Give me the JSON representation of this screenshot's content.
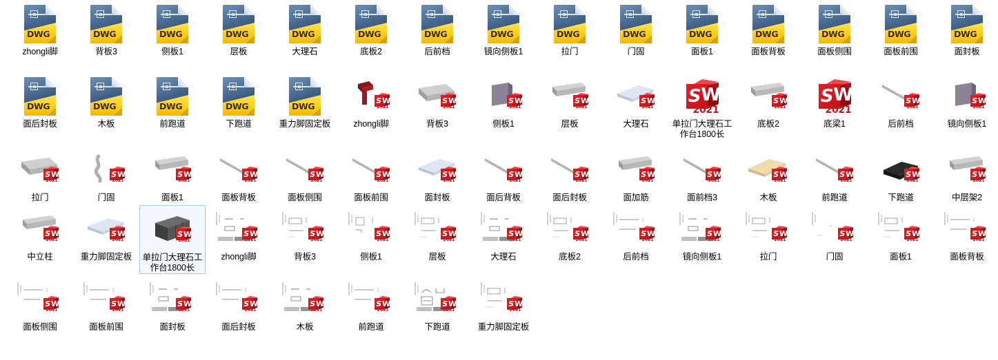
{
  "window": {
    "view_mode": "medium-icons-grid",
    "background_color": "#ffffff",
    "selection_fill": "#f2f8fd",
    "selection_border": "#9fd0ef",
    "columns": 15,
    "rows": 5
  },
  "icons": {
    "dwg_label": "DWG",
    "sw_letter_s": "S",
    "sw_letter_w": "W",
    "sw_year": "2021"
  },
  "items": [
    {
      "label": "zhongli脚",
      "type": "dwg",
      "row": 0,
      "col": 0,
      "selected": false
    },
    {
      "label": "背板3",
      "type": "dwg",
      "row": 0,
      "col": 1,
      "selected": false
    },
    {
      "label": "侧板1",
      "type": "dwg",
      "row": 0,
      "col": 2,
      "selected": false
    },
    {
      "label": "层板",
      "type": "dwg",
      "row": 0,
      "col": 3,
      "selected": false
    },
    {
      "label": "大理石",
      "type": "dwg",
      "row": 0,
      "col": 4,
      "selected": false
    },
    {
      "label": "底板2",
      "type": "dwg",
      "row": 0,
      "col": 5,
      "selected": false
    },
    {
      "label": "后前档",
      "type": "dwg",
      "row": 0,
      "col": 6,
      "selected": false
    },
    {
      "label": "镜向侧板1",
      "type": "dwg",
      "row": 0,
      "col": 7,
      "selected": false
    },
    {
      "label": "拉门",
      "type": "dwg",
      "row": 0,
      "col": 8,
      "selected": false
    },
    {
      "label": "门固",
      "type": "dwg",
      "row": 0,
      "col": 9,
      "selected": false
    },
    {
      "label": "面板1",
      "type": "dwg",
      "row": 0,
      "col": 10,
      "selected": false
    },
    {
      "label": "面板背板",
      "type": "dwg",
      "row": 0,
      "col": 11,
      "selected": false
    },
    {
      "label": "面板侧围",
      "type": "dwg",
      "row": 0,
      "col": 12,
      "selected": false
    },
    {
      "label": "面板前围",
      "type": "dwg",
      "row": 0,
      "col": 13,
      "selected": false
    },
    {
      "label": "面封板",
      "type": "dwg",
      "row": 0,
      "col": 14,
      "selected": false
    },
    {
      "label": "面后封板",
      "type": "dwg",
      "row": 1,
      "col": 0,
      "selected": false
    },
    {
      "label": "木板",
      "type": "dwg",
      "row": 1,
      "col": 1,
      "selected": false
    },
    {
      "label": "前跑道",
      "type": "dwg",
      "row": 1,
      "col": 2,
      "selected": false
    },
    {
      "label": "下跑道",
      "type": "dwg",
      "row": 1,
      "col": 3,
      "selected": false
    },
    {
      "label": "重力脚固定板",
      "type": "dwg",
      "row": 1,
      "col": 4,
      "selected": false
    },
    {
      "label": "zhongli脚",
      "type": "part",
      "shape": "post",
      "row": 1,
      "col": 5,
      "selected": false
    },
    {
      "label": "背板3",
      "type": "part",
      "shape": "panel-grey",
      "row": 1,
      "col": 6,
      "selected": false
    },
    {
      "label": "侧板1",
      "type": "part",
      "shape": "plate-purple",
      "row": 1,
      "col": 7,
      "selected": false
    },
    {
      "label": "层板",
      "type": "part",
      "shape": "bar-grey",
      "row": 1,
      "col": 8,
      "selected": false
    },
    {
      "label": "大理石",
      "type": "part",
      "shape": "slab-white",
      "row": 1,
      "col": 9,
      "selected": false
    },
    {
      "label": "单拉门大理石工作台1800长",
      "type": "assembly-big",
      "row": 1,
      "col": 10,
      "selected": false
    },
    {
      "label": "底板2",
      "type": "part",
      "shape": "bar-grey",
      "row": 1,
      "col": 11,
      "selected": false
    },
    {
      "label": "底梁1",
      "type": "assembly-big",
      "row": 1,
      "col": 12,
      "selected": false
    },
    {
      "label": "后前档",
      "type": "part",
      "shape": "rod-thin",
      "row": 1,
      "col": 13,
      "selected": false
    },
    {
      "label": "镜向侧板1",
      "type": "part",
      "shape": "plate-purple",
      "row": 1,
      "col": 14,
      "selected": false
    },
    {
      "label": "拉门",
      "type": "part",
      "shape": "panel-grey",
      "row": 2,
      "col": 0,
      "selected": false
    },
    {
      "label": "门固",
      "type": "part",
      "shape": "hook-grey",
      "row": 2,
      "col": 1,
      "selected": false
    },
    {
      "label": "面板1",
      "type": "part",
      "shape": "bar-grey",
      "row": 2,
      "col": 2,
      "selected": false
    },
    {
      "label": "面板背板",
      "type": "part",
      "shape": "rod-thin",
      "row": 2,
      "col": 3,
      "selected": false
    },
    {
      "label": "面板侧围",
      "type": "part",
      "shape": "rod-thin",
      "row": 2,
      "col": 4,
      "selected": false
    },
    {
      "label": "面板前围",
      "type": "part",
      "shape": "rod-thin",
      "row": 2,
      "col": 5,
      "selected": false
    },
    {
      "label": "面封板",
      "type": "part",
      "shape": "slab-white",
      "row": 2,
      "col": 6,
      "selected": false
    },
    {
      "label": "面后背板",
      "type": "part",
      "shape": "rod-thin",
      "row": 2,
      "col": 7,
      "selected": false
    },
    {
      "label": "面后封板",
      "type": "part",
      "shape": "rod-thin",
      "row": 2,
      "col": 8,
      "selected": false
    },
    {
      "label": "面加筋",
      "type": "part",
      "shape": "bar-grey",
      "row": 2,
      "col": 9,
      "selected": false
    },
    {
      "label": "面前档3",
      "type": "part",
      "shape": "rod-thin",
      "row": 2,
      "col": 10,
      "selected": false
    },
    {
      "label": "木板",
      "type": "part",
      "shape": "slab-wood",
      "row": 2,
      "col": 11,
      "selected": false
    },
    {
      "label": "前跑道",
      "type": "part",
      "shape": "rod-thin",
      "row": 2,
      "col": 12,
      "selected": false
    },
    {
      "label": "下跑道",
      "type": "part",
      "shape": "block-black",
      "row": 2,
      "col": 13,
      "selected": false
    },
    {
      "label": "中层架2",
      "type": "part",
      "shape": "bar-grey",
      "row": 2,
      "col": 14,
      "selected": false
    },
    {
      "label": "中立柱",
      "type": "part",
      "shape": "bar-grey",
      "row": 3,
      "col": 0,
      "selected": false
    },
    {
      "label": "重力脚固定板",
      "type": "part",
      "shape": "slab-white",
      "row": 3,
      "col": 1,
      "selected": false
    },
    {
      "label": "单拉门大理石工作台1800长",
      "type": "assembly-model",
      "row": 3,
      "col": 2,
      "selected": true
    },
    {
      "label": "zhongli脚",
      "type": "drawing",
      "sheet": "titled",
      "row": 3,
      "col": 3,
      "selected": false
    },
    {
      "label": "背板3",
      "type": "drawing",
      "sheet": "rect-line",
      "row": 3,
      "col": 4,
      "selected": false
    },
    {
      "label": "侧板1",
      "type": "drawing",
      "sheet": "square",
      "row": 3,
      "col": 5,
      "selected": false
    },
    {
      "label": "层板",
      "type": "drawing",
      "sheet": "rect-line",
      "row": 3,
      "col": 6,
      "selected": false
    },
    {
      "label": "大理石",
      "type": "drawing",
      "sheet": "titled",
      "row": 3,
      "col": 7,
      "selected": false
    },
    {
      "label": "底板2",
      "type": "drawing",
      "sheet": "rect-line",
      "row": 3,
      "col": 8,
      "selected": false
    },
    {
      "label": "后前档",
      "type": "drawing",
      "sheet": "lines",
      "row": 3,
      "col": 9,
      "selected": false
    },
    {
      "label": "镜向侧板1",
      "type": "drawing",
      "sheet": "titled",
      "row": 3,
      "col": 10,
      "selected": false
    },
    {
      "label": "拉门",
      "type": "drawing",
      "sheet": "rect-line",
      "row": 3,
      "col": 11,
      "selected": false
    },
    {
      "label": "门固",
      "type": "drawing",
      "sheet": "blank",
      "row": 3,
      "col": 12,
      "selected": false
    },
    {
      "label": "面板1",
      "type": "drawing",
      "sheet": "rect-line",
      "row": 3,
      "col": 13,
      "selected": false
    },
    {
      "label": "面板背板",
      "type": "drawing",
      "sheet": "lines",
      "row": 3,
      "col": 14,
      "selected": false
    },
    {
      "label": "面板侧围",
      "type": "drawing",
      "sheet": "lines",
      "row": 4,
      "col": 0,
      "selected": false
    },
    {
      "label": "面板前围",
      "type": "drawing",
      "sheet": "lines",
      "row": 4,
      "col": 1,
      "selected": false
    },
    {
      "label": "面封板",
      "type": "drawing",
      "sheet": "titled",
      "row": 4,
      "col": 2,
      "selected": false
    },
    {
      "label": "面后封板",
      "type": "drawing",
      "sheet": "lines",
      "row": 4,
      "col": 3,
      "selected": false
    },
    {
      "label": "木板",
      "type": "drawing",
      "sheet": "titled",
      "row": 4,
      "col": 4,
      "selected": false
    },
    {
      "label": "前跑道",
      "type": "drawing",
      "sheet": "lines",
      "row": 4,
      "col": 5,
      "selected": false
    },
    {
      "label": "下跑道",
      "type": "drawing",
      "sheet": "multi",
      "row": 4,
      "col": 6,
      "selected": false
    },
    {
      "label": "重力脚固定板",
      "type": "drawing",
      "sheet": "rect-line",
      "row": 4,
      "col": 7,
      "selected": false
    }
  ]
}
